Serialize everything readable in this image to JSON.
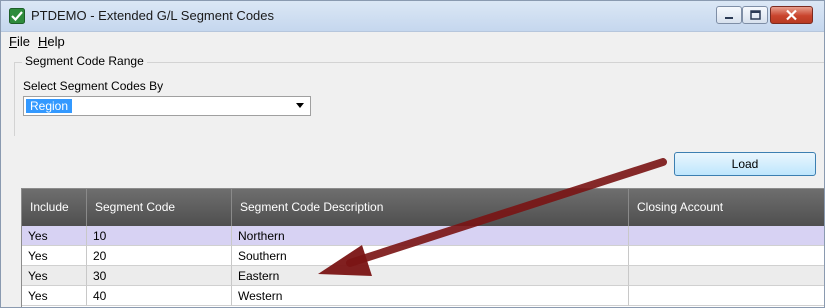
{
  "window": {
    "title": "PTDEMO - Extended G/L Segment Codes"
  },
  "menu": {
    "file": {
      "key": "F",
      "rest": "ile"
    },
    "help": {
      "key": "H",
      "rest": "elp"
    }
  },
  "segment_range": {
    "legend": "Segment Code Range",
    "select_label": "Select Segment Codes By",
    "select_value": "Region"
  },
  "load_button": "Load",
  "grid": {
    "columns": [
      "Include",
      "Segment Code",
      "Segment Code Description",
      "Closing Account"
    ],
    "rows": [
      [
        "Yes",
        "10",
        "Northern",
        ""
      ],
      [
        "Yes",
        "20",
        "Southern",
        ""
      ],
      [
        "Yes",
        "30",
        "Eastern",
        ""
      ],
      [
        "Yes",
        "40",
        "Western",
        ""
      ]
    ]
  },
  "colors": {
    "arrow": "#8b1a1a",
    "selected_row": "#d7d2f3",
    "header": "#5a5a5a"
  },
  "icons": [
    "app-checkmark-icon",
    "minimize-icon",
    "maximize-icon",
    "close-icon",
    "dropdown-arrow-icon",
    "annotation-arrow"
  ]
}
